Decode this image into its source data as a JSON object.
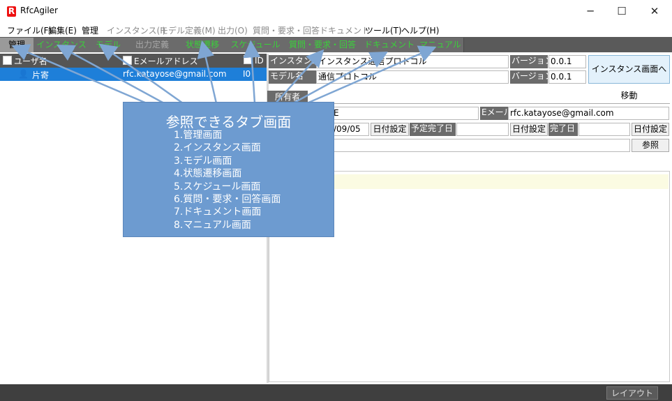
{
  "window": {
    "title": "RfcAgiler",
    "logo": "R",
    "minimize": "─",
    "maximize": "☐",
    "close": "✕"
  },
  "menu": [
    {
      "label": "ファイル(F)",
      "disabled": false
    },
    {
      "label": "編集(E)",
      "disabled": false
    },
    {
      "label": "管理",
      "disabled": false
    },
    {
      "label": "インスタンス(I)",
      "disabled": true
    },
    {
      "label": "モデル定義(M)",
      "disabled": true
    },
    {
      "label": "出力(O)",
      "disabled": true
    },
    {
      "label": "質問・要求・回答",
      "disabled": true
    },
    {
      "label": "ドキュメント",
      "disabled": true
    },
    {
      "label": "ツール(T)",
      "disabled": false
    },
    {
      "label": "ヘルプ(H)",
      "disabled": false
    }
  ],
  "tabs": [
    {
      "label": "管理",
      "state": "active"
    },
    {
      "label": "インスタンス",
      "state": "green"
    },
    {
      "label": "モデル",
      "state": "green"
    },
    {
      "label": "出力定義",
      "state": "grey"
    },
    {
      "label": "状態遷移",
      "state": "green"
    },
    {
      "label": "スケジュール",
      "state": "green"
    },
    {
      "label": "質問・要求・回答",
      "state": "green"
    },
    {
      "label": "ドキュメント",
      "state": "green"
    },
    {
      "label": "マニュアル",
      "state": "green"
    }
  ],
  "user_table": {
    "headers": [
      "ユーザ名",
      "Eメールアドレス",
      "ID"
    ],
    "rows": [
      {
        "name": "片寄",
        "email": "rfc.katayose@gmail.com",
        "id": "I0"
      }
    ]
  },
  "instance": {
    "instance_label": "インスタンス名",
    "instance_name": "インスタンス通信プロトコル",
    "version_label": "バージョン",
    "instance_version": "0.0.1",
    "model_label": "モデル名",
    "model_name": "通信プロトコル",
    "model_version": "0.0.1",
    "nav_button": "インスタンス画面へ移動"
  },
  "owner": {
    "tab_label": "所有者",
    "name_tail": "E",
    "email_label": "Eメール",
    "email": "rfc.katayose@gmail.com",
    "start_date_partial": "/09/05",
    "date_set_button": "日付設定",
    "planned_done_label": "予定完了日",
    "planned_done_value": "",
    "done_label": "完了日",
    "done_value": "",
    "browse_button": "参照"
  },
  "callout": {
    "title": "参照できるタブ画面",
    "items": [
      "1.管理画面",
      "2.インスタンス画面",
      "3.モデル画面",
      "4.状態遷移画面",
      "5.スケジュール画面",
      "6.質問・要求・回答画面",
      "7.ドキュメント画面",
      "8.マニュアル画面"
    ]
  },
  "status": {
    "layout_button": "レイアウト"
  },
  "colors": {
    "tab_green": "#3ad13a",
    "selection": "#1e7fd9",
    "callout": "#6d9bd0",
    "arrow": "#7fa6d3"
  }
}
